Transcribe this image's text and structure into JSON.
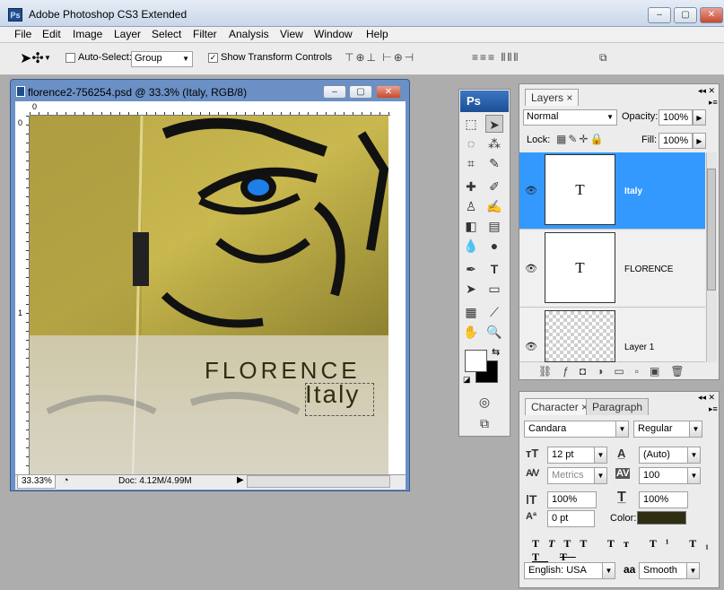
{
  "app": {
    "title": "Adobe Photoshop CS3 Extended",
    "logo": "Ps"
  },
  "window_controls": {
    "minimize": "–",
    "maximize": "▢",
    "close": "✕"
  },
  "menu": [
    "File",
    "Edit",
    "Image",
    "Layer",
    "Select",
    "Filter",
    "Analysis",
    "View",
    "Window",
    "Help"
  ],
  "options": {
    "auto_select_label": "Auto-Select:",
    "auto_select_value": "Group",
    "show_transform_label": "Show Transform Controls"
  },
  "document": {
    "title": "florence2-756254.psd @ 33.3% (Italy, RGB/8)",
    "ruler_h0": "0",
    "ruler_v0": "0",
    "ruler_v1": "1",
    "headline": "FLORENCE",
    "subline": "Italy",
    "zoom": "33.33%",
    "doc_size": "Doc: 4.12M/4.99M"
  },
  "tools": {
    "logo": "Ps"
  },
  "layers": {
    "tab": "Layers",
    "blend_mode": "Normal",
    "opacity_label": "Opacity:",
    "opacity": "100%",
    "lock_label": "Lock:",
    "fill_label": "Fill:",
    "fill": "100%",
    "items": [
      {
        "name": "Italy",
        "thumb": "T"
      },
      {
        "name": "FLORENCE",
        "thumb": "T"
      },
      {
        "name": "Layer 1",
        "thumb": ""
      }
    ]
  },
  "character": {
    "tab1": "Character",
    "tab2": "Paragraph",
    "font": "Candara",
    "style": "Regular",
    "size": "12 pt",
    "leading": "(Auto)",
    "kerning": "Metrics",
    "tracking": "100",
    "vscale": "100%",
    "hscale": "100%",
    "baseline": "0 pt",
    "color_label": "Color:",
    "color": "#2f2e12",
    "language": "English: USA",
    "aa_icon": "aa",
    "antialias": "Smooth"
  },
  "colors": {
    "accent": "#3399ff",
    "titlebar": "#c9d7ea",
    "doc_frame": "#6a90c6"
  }
}
